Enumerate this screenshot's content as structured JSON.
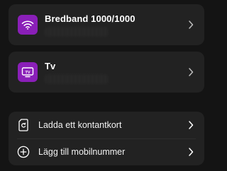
{
  "colors": {
    "background": "#141414",
    "card": "#222222",
    "accent_purple": "#8a1fb8",
    "text": "#ffffff",
    "chevron": "#bdbdbd"
  },
  "services": [
    {
      "title": "Bredband 1000/1000",
      "icon": "wifi-icon"
    },
    {
      "title": "Tv",
      "icon": "tv-icon"
    }
  ],
  "actions": [
    {
      "label": "Ladda ett kontantkort",
      "icon": "sim-card-icon"
    },
    {
      "label": "Lägg till mobilnummer",
      "icon": "plus-circle-icon"
    }
  ]
}
